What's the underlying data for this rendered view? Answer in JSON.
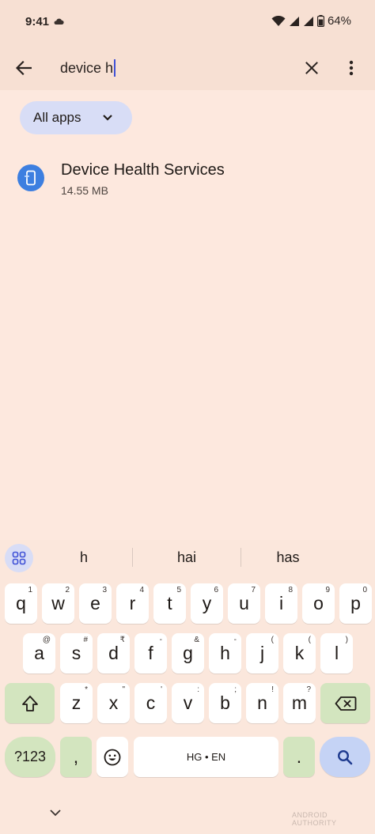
{
  "status_bar": {
    "time": "9:41",
    "battery_percent": "64%"
  },
  "search": {
    "query": "device h"
  },
  "filter_chip": {
    "label": "All apps"
  },
  "results": [
    {
      "name": "Device Health Services",
      "size": "14.55 MB"
    }
  ],
  "keyboard": {
    "suggestions": [
      "h",
      "hai",
      "has"
    ],
    "row1": [
      {
        "k": "q",
        "h": "1"
      },
      {
        "k": "w",
        "h": "2"
      },
      {
        "k": "e",
        "h": "3"
      },
      {
        "k": "r",
        "h": "4"
      },
      {
        "k": "t",
        "h": "5"
      },
      {
        "k": "y",
        "h": "6"
      },
      {
        "k": "u",
        "h": "7"
      },
      {
        "k": "i",
        "h": "8"
      },
      {
        "k": "o",
        "h": "9"
      },
      {
        "k": "p",
        "h": "0"
      }
    ],
    "row2": [
      {
        "k": "a",
        "h": "@"
      },
      {
        "k": "s",
        "h": "#"
      },
      {
        "k": "d",
        "h": "₹"
      },
      {
        "k": "f",
        "h": "-"
      },
      {
        "k": "g",
        "h": "&"
      },
      {
        "k": "h",
        "h": "-"
      },
      {
        "k": "j",
        "h": "("
      },
      {
        "k": "k",
        "h": "("
      },
      {
        "k": "l",
        "h": ")"
      }
    ],
    "row3": [
      {
        "k": "z",
        "h": "*"
      },
      {
        "k": "x",
        "h": "\""
      },
      {
        "k": "c",
        "h": "'"
      },
      {
        "k": "v",
        "h": ":"
      },
      {
        "k": "b",
        "h": ";"
      },
      {
        "k": "n",
        "h": "!"
      },
      {
        "k": "m",
        "h": "?"
      }
    ],
    "symbols_label": "?123",
    "comma": ",",
    "space_label": "HG • EN",
    "period": "."
  },
  "watermark": "ANDROID AUTHORITY",
  "colors": {
    "background": "#fde8de",
    "chip": "#d8ddf6",
    "accent_green": "#d3e5bf",
    "search_key": "#c5d3f5",
    "app_icon": "#3d7fe0"
  }
}
